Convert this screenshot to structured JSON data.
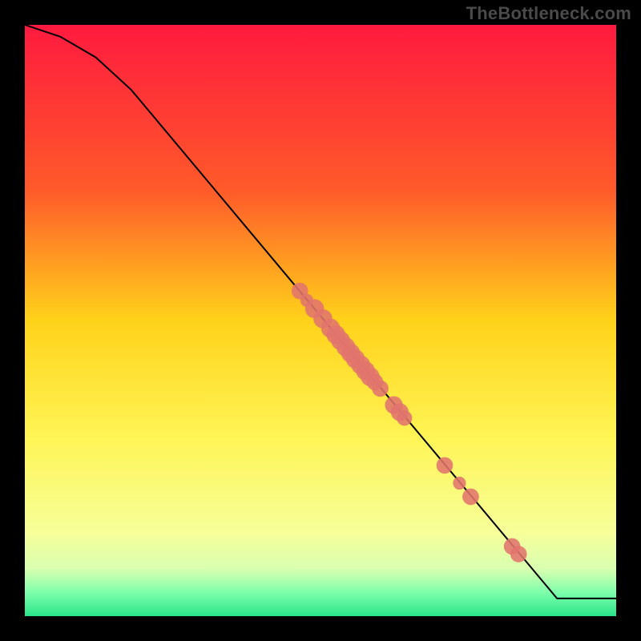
{
  "watermark": "TheBottleneck.com",
  "chart_data": {
    "type": "line",
    "title": "",
    "xlabel": "",
    "ylabel": "",
    "xlim": [
      0,
      100
    ],
    "ylim": [
      0,
      100
    ],
    "gradient_stops": [
      {
        "offset": 0,
        "color": "#ff1a3f"
      },
      {
        "offset": 28,
        "color": "#ff5a2a"
      },
      {
        "offset": 50,
        "color": "#ffd21a"
      },
      {
        "offset": 70,
        "color": "#fff556"
      },
      {
        "offset": 86,
        "color": "#f6ff9a"
      },
      {
        "offset": 92,
        "color": "#d9ffb0"
      },
      {
        "offset": 96,
        "color": "#7dffab"
      },
      {
        "offset": 100,
        "color": "#29e48a"
      }
    ],
    "curve": [
      {
        "x": 0,
        "y": 100
      },
      {
        "x": 6,
        "y": 98
      },
      {
        "x": 12,
        "y": 94.5
      },
      {
        "x": 18,
        "y": 89
      },
      {
        "x": 90,
        "y": 3
      },
      {
        "x": 100,
        "y": 3
      }
    ],
    "markers": {
      "color": "#e1746d",
      "points": [
        {
          "x": 46.5,
          "y": 55.0,
          "r": 1.4
        },
        {
          "x": 47.7,
          "y": 53.4,
          "r": 1.1
        },
        {
          "x": 49.0,
          "y": 52.0,
          "r": 1.6
        },
        {
          "x": 50.4,
          "y": 50.3,
          "r": 1.6
        },
        {
          "x": 51.7,
          "y": 48.7,
          "r": 1.6
        },
        {
          "x": 52.6,
          "y": 47.6,
          "r": 1.6
        },
        {
          "x": 53.4,
          "y": 46.6,
          "r": 1.6
        },
        {
          "x": 54.3,
          "y": 45.5,
          "r": 1.6
        },
        {
          "x": 55.1,
          "y": 44.5,
          "r": 1.6
        },
        {
          "x": 55.9,
          "y": 43.5,
          "r": 1.6
        },
        {
          "x": 56.8,
          "y": 42.5,
          "r": 1.6
        },
        {
          "x": 57.6,
          "y": 41.5,
          "r": 1.6
        },
        {
          "x": 58.4,
          "y": 40.5,
          "r": 1.6
        },
        {
          "x": 59.2,
          "y": 39.6,
          "r": 1.4
        },
        {
          "x": 60.1,
          "y": 38.5,
          "r": 1.4
        },
        {
          "x": 62.4,
          "y": 35.7,
          "r": 1.5
        },
        {
          "x": 63.4,
          "y": 34.5,
          "r": 1.5
        },
        {
          "x": 64.2,
          "y": 33.5,
          "r": 1.3
        },
        {
          "x": 71.0,
          "y": 25.5,
          "r": 1.4
        },
        {
          "x": 73.5,
          "y": 22.5,
          "r": 1.1
        },
        {
          "x": 75.4,
          "y": 20.2,
          "r": 1.4
        },
        {
          "x": 82.4,
          "y": 11.8,
          "r": 1.4
        },
        {
          "x": 83.5,
          "y": 10.5,
          "r": 1.4
        }
      ]
    }
  }
}
